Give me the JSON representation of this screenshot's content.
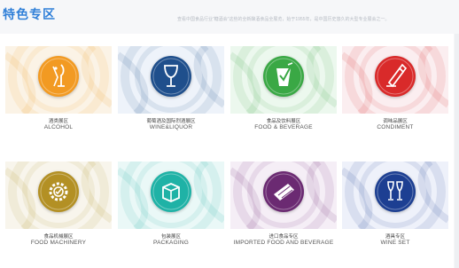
{
  "header": {
    "title": "特色专区",
    "subtitle": "查看中国食品行业“糖酒会”这些的全新酿酒食品全展览，始于1955年，是中国历史悠久的大型专业展会之一。"
  },
  "categories": [
    {
      "cn": "酒类展区",
      "en": "ALCOHOL",
      "icon": "wine-pour-icon",
      "color": "#f29a22",
      "tile": "#fbf3e6"
    },
    {
      "cn": "葡萄酒及国际烈酒展区",
      "en": "WINE&LIQUOR",
      "icon": "wine-glass-icon",
      "color": "#1f4f8c",
      "tile": "#eef3fa"
    },
    {
      "cn": "食品及饮料展区",
      "en": "FOOD & BEVERAGE",
      "icon": "drink-cup-icon",
      "color": "#3aa845",
      "tile": "#ecf8ee"
    },
    {
      "cn": "调味品展区",
      "en": "CONDIMENT",
      "icon": "seasoning-icon",
      "color": "#d92a2a",
      "tile": "#fbeef0"
    },
    {
      "cn": "食品机械展区",
      "en": "FOOD MACHINERY",
      "icon": "gear-icon",
      "color": "#b39024",
      "tile": "#f8f5ec"
    },
    {
      "cn": "包装展区",
      "en": "PACKAGING",
      "icon": "box-icon",
      "color": "#1fb2a6",
      "tile": "#eaf8f7"
    },
    {
      "cn": "进口食品专区",
      "en": "IMPORTED FOOD AND BEVERAGE",
      "icon": "chocolate-bar-icon",
      "color": "#6b2a72",
      "tile": "#f5eef6"
    },
    {
      "cn": "酒具专区",
      "en": "WINE SET",
      "icon": "wine-glasses-icon",
      "color": "#1d3f92",
      "tile": "#eef1fa"
    }
  ]
}
